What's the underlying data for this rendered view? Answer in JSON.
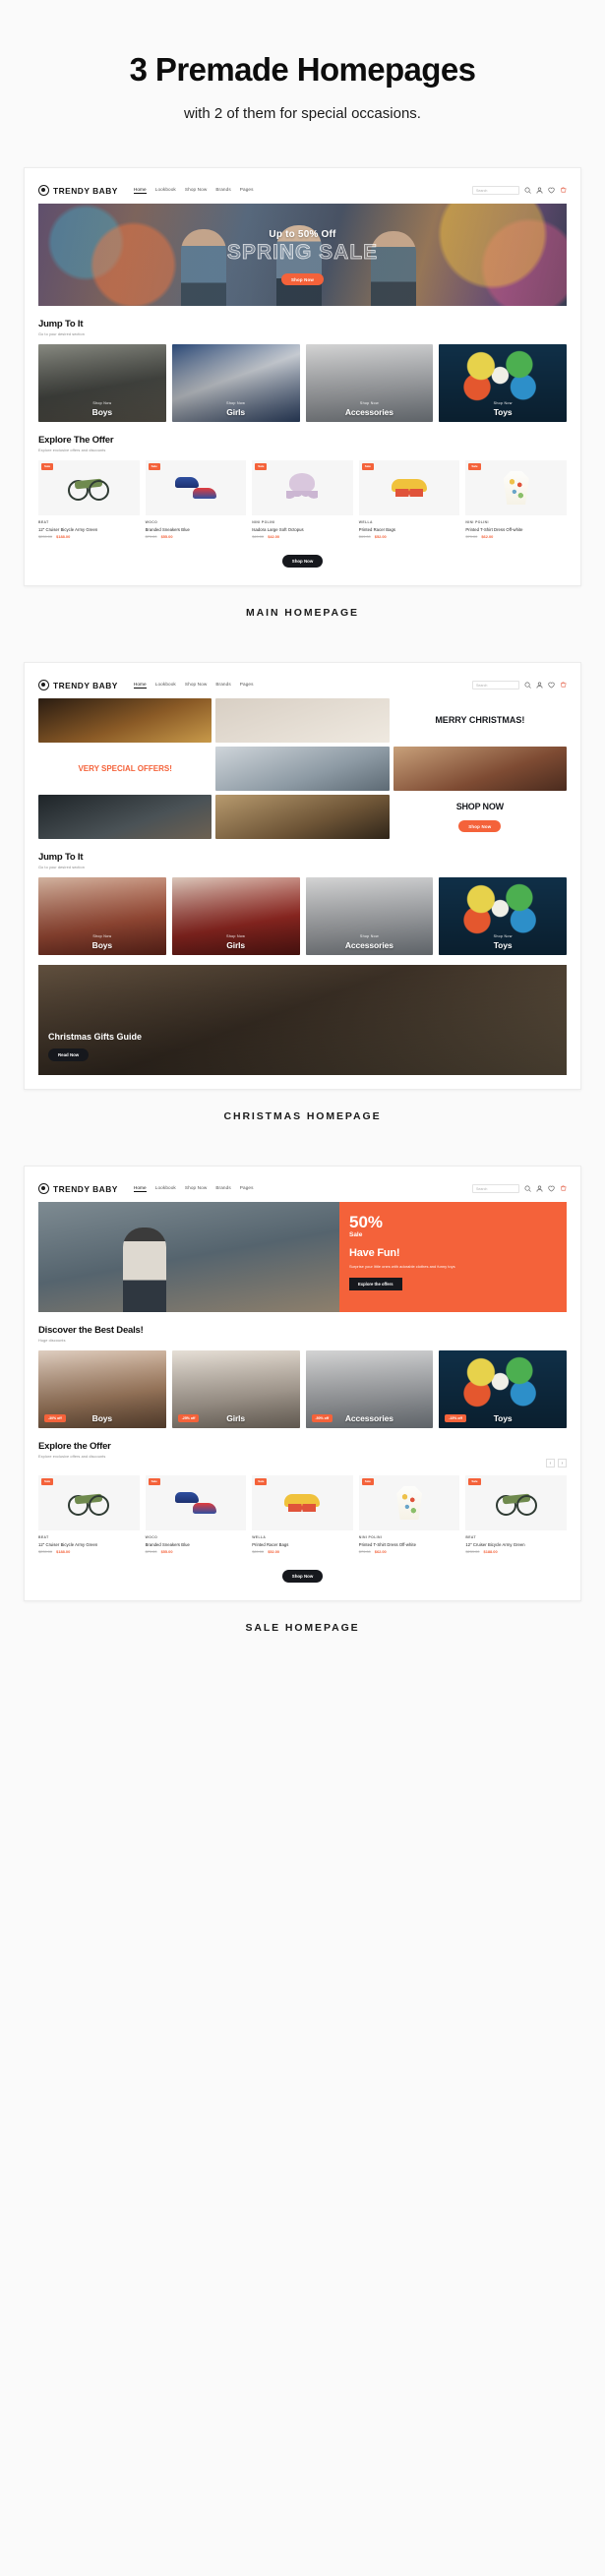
{
  "headline": "3 Premade Homepages",
  "subhead": "with 2 of them for special occasions.",
  "brand": {
    "name": "TRENDY BABY"
  },
  "nav": [
    {
      "label": "Home",
      "active": true
    },
    {
      "label": "Lookbook",
      "active": false
    },
    {
      "label": "Shop Now",
      "active": false
    },
    {
      "label": "Brands",
      "active": false
    },
    {
      "label": "Pages",
      "active": false
    }
  ],
  "search": {
    "placeholder": "Search"
  },
  "head_icons": [
    "search-icon",
    "user-icon",
    "heart-icon",
    "cart-icon"
  ],
  "mockups": [
    {
      "caption": "MAIN HOMEPAGE",
      "hero": {
        "small": "Up to 50% Off",
        "big": "SPRING SALE",
        "cta": "Shop Now"
      },
      "jump": {
        "title": "Jump To It",
        "sub": "Go to your desired section"
      },
      "categories": [
        {
          "shop": "Shop Now",
          "label": "Boys"
        },
        {
          "shop": "Shop Now",
          "label": "Girls"
        },
        {
          "shop": "Shop Now",
          "label": "Accessories"
        },
        {
          "shop": "Shop Now",
          "label": "Toys"
        }
      ],
      "offer": {
        "title": "Explore The Offer",
        "sub": "Explore exclusive offers and discounts"
      },
      "products": [
        {
          "tag": "Sale",
          "brand": "BEAT",
          "name": "12\" Cruiser Bicycle Army Green",
          "old": "$239.00",
          "new": "$188.00"
        },
        {
          "tag": "Sale",
          "brand": "WOCO",
          "name": "Branded Sneakers Blue",
          "old": "$79.00",
          "new": "$55.00"
        },
        {
          "tag": "Sale",
          "brand": "NINI POLINI",
          "name": "Isadora Large Soft Octopus",
          "old": "$49.00",
          "new": "$42.00"
        },
        {
          "tag": "Sale",
          "brand": "WELLA",
          "name": "Printed Racer Bags",
          "old": "$69.00",
          "new": "$52.00"
        },
        {
          "tag": "Sale",
          "brand": "NINI POLINI",
          "name": "Printed T-Shirt Dress Off-white",
          "old": "$79.00",
          "new": "$62.00"
        }
      ],
      "shop_all": "Shop Now"
    },
    {
      "caption": "CHRISTMAS HOMEPAGE",
      "merry": "MERRY CHRISTMAS!",
      "special": "VERY SPECIAL OFFERS!",
      "shop_now_big": "SHOP NOW",
      "cta": "Shop Now",
      "jump": {
        "title": "Jump To It",
        "sub": "Go to your desired section"
      },
      "categories": [
        {
          "shop": "Shop Now",
          "label": "Boys"
        },
        {
          "shop": "Shop Now",
          "label": "Girls"
        },
        {
          "shop": "Shop Now",
          "label": "Accessories"
        },
        {
          "shop": "Shop Now",
          "label": "Toys"
        }
      ],
      "banner": {
        "title": "Christmas Gifts Guide",
        "cta": "Read Now"
      }
    },
    {
      "caption": "SALE HOMEPAGE",
      "hero": {
        "pct": "50%",
        "sale": "Sale",
        "title": "Have Fun!",
        "desc": "Surprise your little ones with adorable clothes and funny toys",
        "cta": "Explore the offers"
      },
      "discover": {
        "title": "Discover the Best Deals!",
        "sub": "Huge discounts"
      },
      "categories": [
        {
          "label": "Boys",
          "badge": "-30% off"
        },
        {
          "label": "Girls",
          "badge": "-25% off"
        },
        {
          "label": "Accessories",
          "badge": "-50% off"
        },
        {
          "label": "Toys",
          "badge": "-15% off"
        }
      ],
      "offer": {
        "title": "Explore the Offer",
        "sub": "Explore exclusive offers and discounts"
      },
      "products": [
        {
          "tag": "Sale",
          "brand": "BEAT",
          "name": "12\" Cruiser Bicycle Army Green",
          "old": "$239.00",
          "new": "$188.00"
        },
        {
          "tag": "Sale",
          "brand": "WOCO",
          "name": "Branded Sneakers Blue",
          "old": "$79.00",
          "new": "$55.00"
        },
        {
          "tag": "Sale",
          "brand": "WELLA",
          "name": "Printed Racer Bags",
          "old": "$69.00",
          "new": "$52.00"
        },
        {
          "tag": "Sale",
          "brand": "NINI POLINI",
          "name": "Printed T-Shirt Dress Off-white",
          "old": "$79.00",
          "new": "$62.00"
        },
        {
          "tag": "Sale",
          "brand": "BEAT",
          "name": "12\" Cruiser Bicycle Army Green",
          "old": "$239.00",
          "new": "$188.00"
        }
      ],
      "shop_all": "Shop Now"
    }
  ],
  "colors": {
    "accent": "#f4623a",
    "dark": "#16181d",
    "page_bg": "#fafafa"
  }
}
